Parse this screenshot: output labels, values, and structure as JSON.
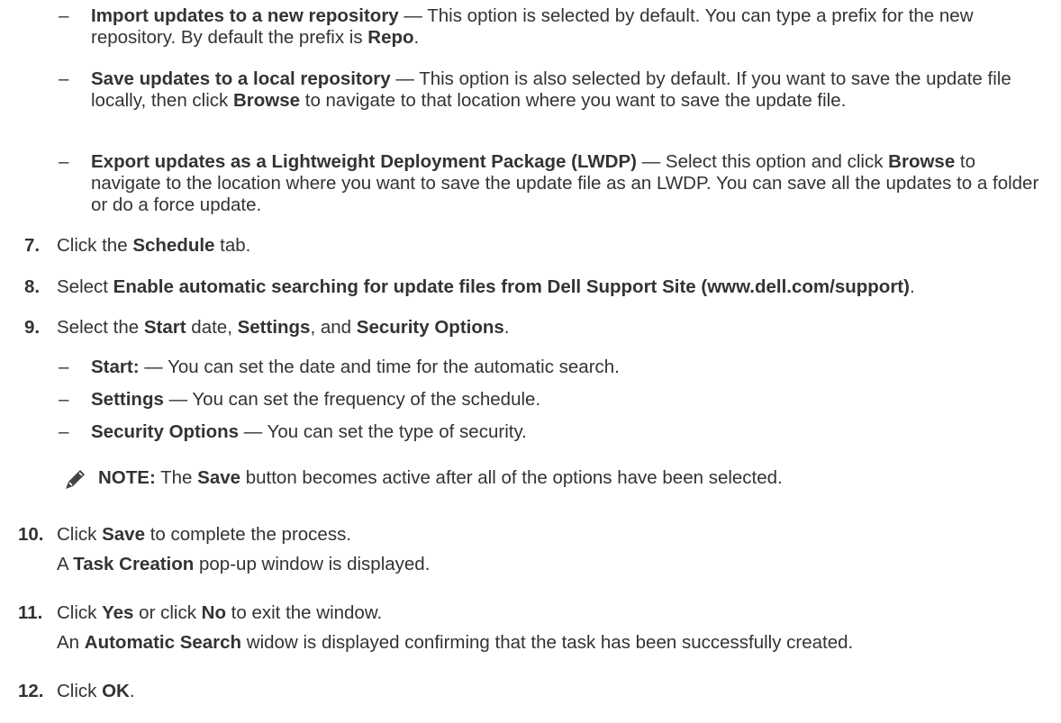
{
  "subs_a": [
    {
      "dash": "–",
      "bold": "Import updates to a new repository",
      "t1": " — This option is selected by default. You can type a prefix for the new repository. By default the prefix is ",
      "b2": "Repo",
      "t2": "."
    },
    {
      "dash": "–",
      "bold": "Save updates to a local repository",
      "t1": " — This option is also selected by default. If you want to save the update file locally, then click ",
      "b2": "Browse",
      "t2": " to navigate to that location where you want to save the update file."
    },
    {
      "dash": "–",
      "bold": "Export updates as a Lightweight Deployment Package (LWDP)",
      "t1": " — Select this option and click ",
      "b2": "Browse",
      "t2": " to navigate to the location where you want to save the update file as an LWDP. You can save all the updates to a folder or do a force update."
    }
  ],
  "step7": {
    "num": "7.",
    "t1": "Click the ",
    "b1": "Schedule",
    "t2": " tab."
  },
  "step8": {
    "num": "8.",
    "t1": "Select ",
    "b1": "Enable automatic searching for update files from Dell Support Site (www.dell.com/support)",
    "t2": "."
  },
  "step9": {
    "num": "9.",
    "t1": "Select the ",
    "b1": "Start",
    "t2": " date, ",
    "b2": "Settings",
    "t3": ", and ",
    "b3": "Security Options",
    "t4": "."
  },
  "subs_b": [
    {
      "dash": "–",
      "bold": "Start:",
      "rest": " — You can set the date and time for the automatic search."
    },
    {
      "dash": "–",
      "bold": "Settings",
      "rest": " — You can set the frequency of the schedule."
    },
    {
      "dash": "–",
      "bold": "Security Options",
      "rest": " — You can set the type of security."
    }
  ],
  "note": {
    "label": "NOTE:",
    "t1": " The ",
    "b1": "Save",
    "t2": " button becomes active after all of the options have been selected.",
    "icon": "note-pencil-icon"
  },
  "step10": {
    "num": "10.",
    "t1": "Click ",
    "b1": "Save",
    "t2": " to complete the process.",
    "c1": "A ",
    "cb1": "Task Creation",
    "c2": " pop-up window is displayed."
  },
  "step11": {
    "num": "11.",
    "t1": "Click ",
    "b1": "Yes",
    "t2": " or click ",
    "b2": "No",
    "t3": " to exit the window.",
    "c1": "An ",
    "cb1": "Automatic Search",
    "c2": " widow is displayed confirming that the task has been successfully created."
  },
  "step12": {
    "num": "12.",
    "t1": "Click ",
    "b1": "OK",
    "t2": "."
  }
}
